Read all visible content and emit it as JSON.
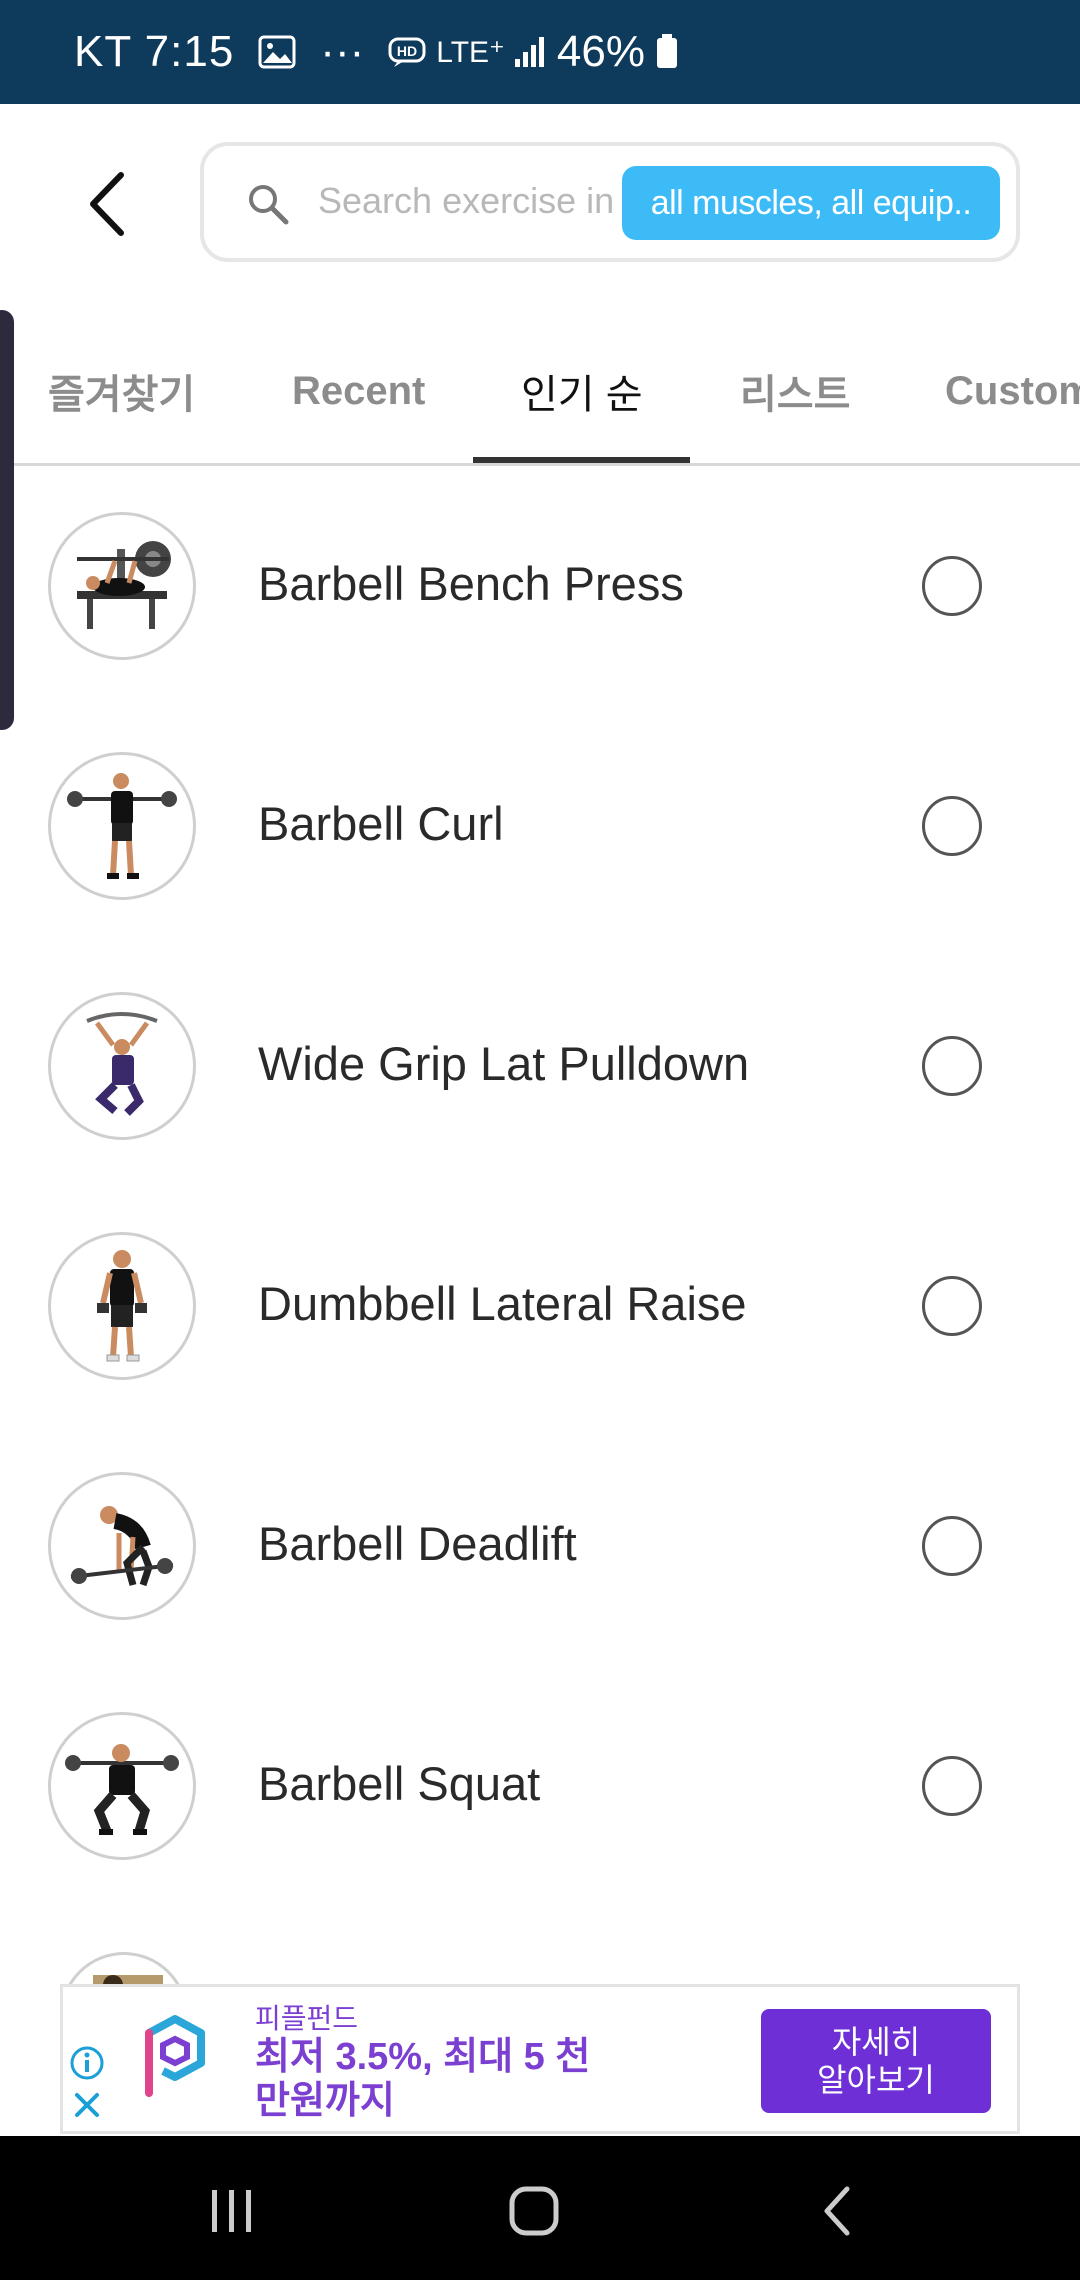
{
  "status_bar": {
    "carrier_time": "KT 7:15",
    "more": "···",
    "network": "LTE⁺",
    "battery_percent": "46%",
    "icons": [
      "image-icon",
      "hd-icon",
      "signal-icon",
      "battery-icon"
    ]
  },
  "header": {
    "back_icon": "chevron-left-icon",
    "search": {
      "placeholder": "Search exercise in",
      "filter_label": "all muscles, all equip.."
    }
  },
  "tabs": [
    {
      "label": "즐겨찾기",
      "active": false
    },
    {
      "label": "Recent",
      "active": false
    },
    {
      "label": "인기 순",
      "active": true
    },
    {
      "label": "리스트",
      "active": false
    },
    {
      "label": "Custom",
      "active": false
    }
  ],
  "exercises": [
    {
      "name": "Barbell Bench Press",
      "selected": false
    },
    {
      "name": "Barbell Curl",
      "selected": false
    },
    {
      "name": "Wide Grip Lat Pulldown",
      "selected": false
    },
    {
      "name": "Dumbbell Lateral Raise",
      "selected": false
    },
    {
      "name": "Barbell Deadlift",
      "selected": false
    },
    {
      "name": "Barbell Squat",
      "selected": false
    }
  ],
  "ad": {
    "advertiser": "피플펀드",
    "headline": "최저 3.5%, 최대 5 천만원까지",
    "cta": "자세히\n알아보기"
  },
  "nav": {
    "icons": [
      "recent-apps-icon",
      "home-icon",
      "back-nav-icon"
    ]
  },
  "colors": {
    "status_bar": "#0e3a5c",
    "filter_pill": "#3dbbf7",
    "ad_accent": "#7b3fd1",
    "ad_button": "#6f2fd6"
  }
}
